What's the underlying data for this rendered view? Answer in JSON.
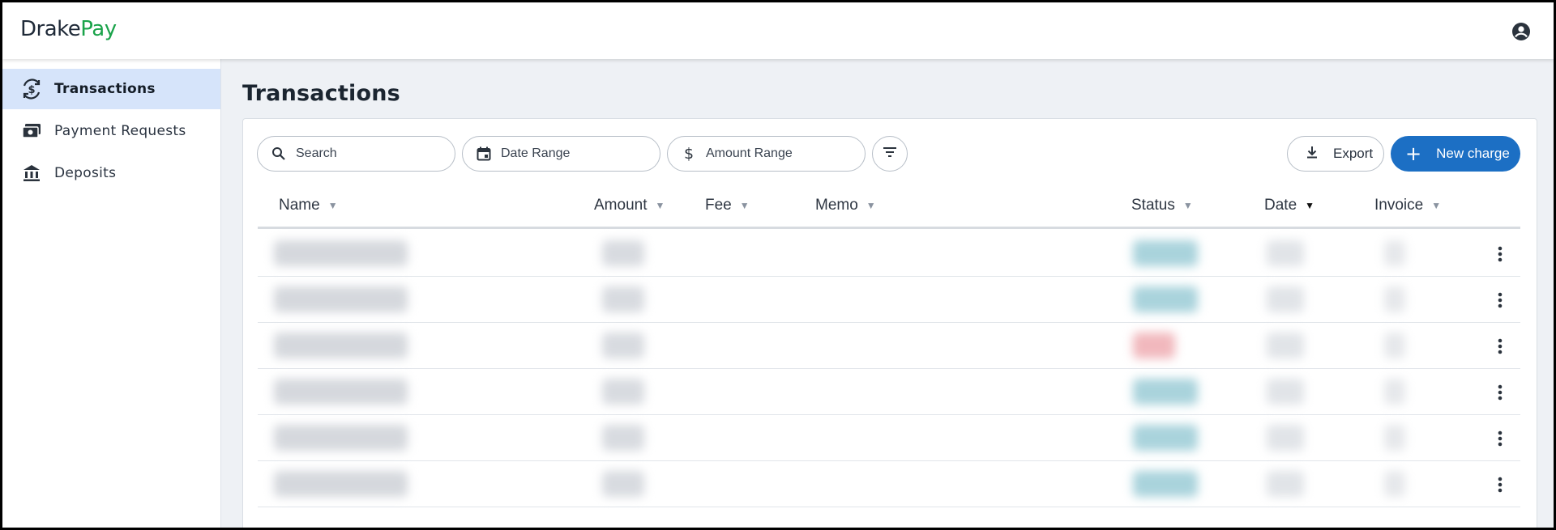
{
  "app": {
    "logo_part1": "Drake",
    "logo_part2": "Pay",
    "brand_color": "#1aa34a",
    "account_icon": "account-circle-icon"
  },
  "sidebar": {
    "items": [
      {
        "label": "Transactions",
        "icon": "transactions-icon",
        "active": true
      },
      {
        "label": "Payment Requests",
        "icon": "payment-requests-icon",
        "active": false
      },
      {
        "label": "Deposits",
        "icon": "bank-icon",
        "active": false
      }
    ]
  },
  "main": {
    "title": "Transactions"
  },
  "toolbar": {
    "search_placeholder": "Search",
    "date_range_label": "Date Range",
    "amount_range_label": "Amount Range",
    "filter_icon": "filter-icon",
    "export_label": "Export",
    "new_charge_label": "New charge",
    "accent_color": "#1c6fc4"
  },
  "table": {
    "columns": [
      {
        "label": "Name",
        "sorted": false
      },
      {
        "label": "Amount",
        "sorted": false
      },
      {
        "label": "Fee",
        "sorted": false
      },
      {
        "label": "Memo",
        "sorted": false
      },
      {
        "label": "Status",
        "sorted": false
      },
      {
        "label": "Date",
        "sorted": true
      },
      {
        "label": "Invoice",
        "sorted": false
      }
    ],
    "sort_indicator": "▼",
    "rows": [
      {
        "status_color": "#a9d3dc",
        "row_menu_icon": "more-vertical-icon"
      },
      {
        "status_color": "#a9d3dc",
        "row_menu_icon": "more-vertical-icon"
      },
      {
        "status_color": "#f1b8bd",
        "row_menu_icon": "more-vertical-icon"
      },
      {
        "status_color": "#a9d3dc",
        "row_menu_icon": "more-vertical-icon"
      },
      {
        "status_color": "#a9d3dc",
        "row_menu_icon": "more-vertical-icon"
      },
      {
        "status_color": "#a9d3dc",
        "row_menu_icon": "more-vertical-icon"
      }
    ],
    "values_obscured": true
  }
}
